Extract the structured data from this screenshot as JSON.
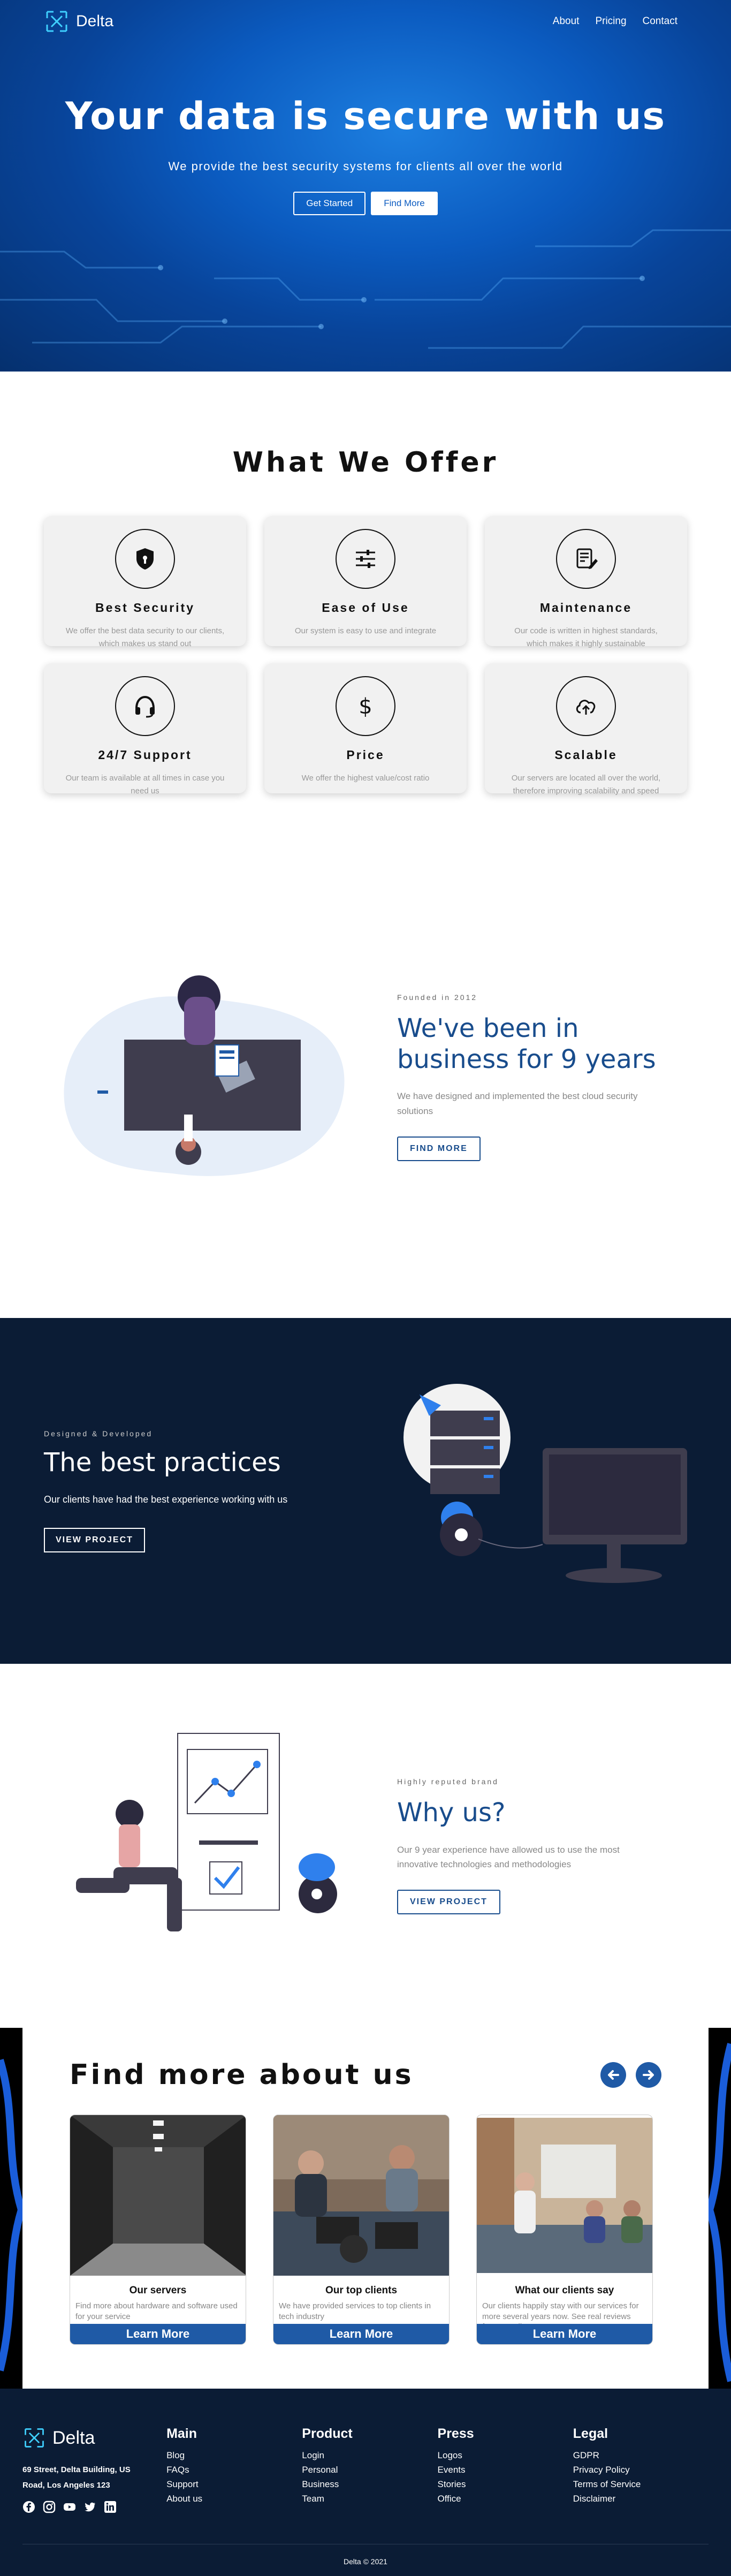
{
  "nav": {
    "brand": "Delta",
    "links": [
      "About",
      "Pricing",
      "Contact"
    ]
  },
  "hero": {
    "title": "Your data is secure with us",
    "subtitle": "We provide the best security systems for clients all over the world",
    "primary_button": "Get Started",
    "secondary_button": "Find More"
  },
  "offer": {
    "title": "What We Offer",
    "cards": [
      {
        "title": "Best Security",
        "text": "We offer the best data security to our clients, which makes us stand out",
        "icon": "shield-icon"
      },
      {
        "title": "Ease of Use",
        "text": "Our system is easy to use and integrate",
        "icon": "sliders-icon"
      },
      {
        "title": "Maintenance",
        "text": "Our code is written in highest standards, which makes it highly sustainable",
        "icon": "edit-document-icon"
      },
      {
        "title": "24/7 Support",
        "text": "Our team is available at all times in case you need us",
        "icon": "headset-icon"
      },
      {
        "title": "Price",
        "text": "We offer the highest value/cost ratio",
        "icon": "dollar-icon"
      },
      {
        "title": "Scalable",
        "text": "Our servers are located all over the world, therefore improving scalability and speed",
        "icon": "cloud-upload-icon"
      }
    ]
  },
  "founded": {
    "eyebrow": "Founded in 2012",
    "title": "We've been in business for 9 years",
    "text": "We have designed and implemented the best cloud security solutions",
    "button": "FIND MORE"
  },
  "practices": {
    "eyebrow": "Designed & Developed",
    "title": "The best practices",
    "text": "Our clients have had the best experience working with us",
    "button": "VIEW PROJECT"
  },
  "why": {
    "eyebrow": "Highly reputed brand",
    "title": "Why us?",
    "text": "Our 9 year experience have allowed us to use the most innovative technologies and methodologies",
    "button": "VIEW PROJECT"
  },
  "findmore": {
    "title": "Find more about us",
    "cards": [
      {
        "title": "Our servers",
        "text": "Find more about hardware and software used for your service",
        "button": "Learn More"
      },
      {
        "title": "Our top clients",
        "text": "We have provided services to top clients in tech industry",
        "button": "Learn More"
      },
      {
        "title": "What our clients say",
        "text": "Our clients happily stay with our services for more several years now. See real reviews from our clients.",
        "button": "Learn More"
      }
    ]
  },
  "footer": {
    "brand": "Delta",
    "address": "69 Street, Delta Building, US Road, Los Angeles 123",
    "social_icons": [
      "facebook-icon",
      "instagram-icon",
      "youtube-icon",
      "twitter-icon",
      "linkedin-icon"
    ],
    "columns": [
      {
        "title": "Main",
        "items": [
          "Blog",
          "FAQs",
          "Support",
          "About us"
        ]
      },
      {
        "title": "Product",
        "items": [
          "Login",
          "Personal",
          "Business",
          "Team"
        ]
      },
      {
        "title": "Press",
        "items": [
          "Logos",
          "Events",
          "Stories",
          "Office"
        ]
      },
      {
        "title": "Legal",
        "items": [
          "GDPR",
          "Privacy Policy",
          "Terms of Service",
          "Disclaimer"
        ]
      }
    ],
    "copyright": "Delta © 2021"
  },
  "colors": {
    "brand_blue": "#184c8c",
    "navy": "#0b1c35",
    "accent_blue": "#1f5aa6"
  }
}
